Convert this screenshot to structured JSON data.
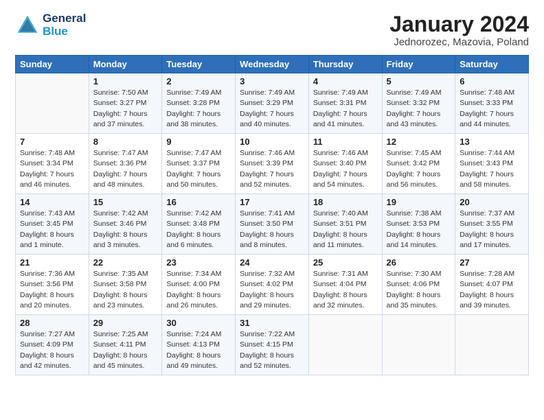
{
  "header": {
    "logo_line1": "General",
    "logo_line2": "Blue",
    "title": "January 2024",
    "subtitle": "Jednorozec, Mazovia, Poland"
  },
  "weekdays": [
    "Sunday",
    "Monday",
    "Tuesday",
    "Wednesday",
    "Thursday",
    "Friday",
    "Saturday"
  ],
  "weeks": [
    [
      {
        "day": "",
        "info": ""
      },
      {
        "day": "1",
        "info": "Sunrise: 7:50 AM\nSunset: 3:27 PM\nDaylight: 7 hours\nand 37 minutes."
      },
      {
        "day": "2",
        "info": "Sunrise: 7:49 AM\nSunset: 3:28 PM\nDaylight: 7 hours\nand 38 minutes."
      },
      {
        "day": "3",
        "info": "Sunrise: 7:49 AM\nSunset: 3:29 PM\nDaylight: 7 hours\nand 40 minutes."
      },
      {
        "day": "4",
        "info": "Sunrise: 7:49 AM\nSunset: 3:31 PM\nDaylight: 7 hours\nand 41 minutes."
      },
      {
        "day": "5",
        "info": "Sunrise: 7:49 AM\nSunset: 3:32 PM\nDaylight: 7 hours\nand 43 minutes."
      },
      {
        "day": "6",
        "info": "Sunrise: 7:48 AM\nSunset: 3:33 PM\nDaylight: 7 hours\nand 44 minutes."
      }
    ],
    [
      {
        "day": "7",
        "info": "Sunrise: 7:48 AM\nSunset: 3:34 PM\nDaylight: 7 hours\nand 46 minutes."
      },
      {
        "day": "8",
        "info": "Sunrise: 7:47 AM\nSunset: 3:36 PM\nDaylight: 7 hours\nand 48 minutes."
      },
      {
        "day": "9",
        "info": "Sunrise: 7:47 AM\nSunset: 3:37 PM\nDaylight: 7 hours\nand 50 minutes."
      },
      {
        "day": "10",
        "info": "Sunrise: 7:46 AM\nSunset: 3:39 PM\nDaylight: 7 hours\nand 52 minutes."
      },
      {
        "day": "11",
        "info": "Sunrise: 7:46 AM\nSunset: 3:40 PM\nDaylight: 7 hours\nand 54 minutes."
      },
      {
        "day": "12",
        "info": "Sunrise: 7:45 AM\nSunset: 3:42 PM\nDaylight: 7 hours\nand 56 minutes."
      },
      {
        "day": "13",
        "info": "Sunrise: 7:44 AM\nSunset: 3:43 PM\nDaylight: 7 hours\nand 58 minutes."
      }
    ],
    [
      {
        "day": "14",
        "info": "Sunrise: 7:43 AM\nSunset: 3:45 PM\nDaylight: 8 hours\nand 1 minute."
      },
      {
        "day": "15",
        "info": "Sunrise: 7:42 AM\nSunset: 3:46 PM\nDaylight: 8 hours\nand 3 minutes."
      },
      {
        "day": "16",
        "info": "Sunrise: 7:42 AM\nSunset: 3:48 PM\nDaylight: 8 hours\nand 6 minutes."
      },
      {
        "day": "17",
        "info": "Sunrise: 7:41 AM\nSunset: 3:50 PM\nDaylight: 8 hours\nand 8 minutes."
      },
      {
        "day": "18",
        "info": "Sunrise: 7:40 AM\nSunset: 3:51 PM\nDaylight: 8 hours\nand 11 minutes."
      },
      {
        "day": "19",
        "info": "Sunrise: 7:38 AM\nSunset: 3:53 PM\nDaylight: 8 hours\nand 14 minutes."
      },
      {
        "day": "20",
        "info": "Sunrise: 7:37 AM\nSunset: 3:55 PM\nDaylight: 8 hours\nand 17 minutes."
      }
    ],
    [
      {
        "day": "21",
        "info": "Sunrise: 7:36 AM\nSunset: 3:56 PM\nDaylight: 8 hours\nand 20 minutes."
      },
      {
        "day": "22",
        "info": "Sunrise: 7:35 AM\nSunset: 3:58 PM\nDaylight: 8 hours\nand 23 minutes."
      },
      {
        "day": "23",
        "info": "Sunrise: 7:34 AM\nSunset: 4:00 PM\nDaylight: 8 hours\nand 26 minutes."
      },
      {
        "day": "24",
        "info": "Sunrise: 7:32 AM\nSunset: 4:02 PM\nDaylight: 8 hours\nand 29 minutes."
      },
      {
        "day": "25",
        "info": "Sunrise: 7:31 AM\nSunset: 4:04 PM\nDaylight: 8 hours\nand 32 minutes."
      },
      {
        "day": "26",
        "info": "Sunrise: 7:30 AM\nSunset: 4:06 PM\nDaylight: 8 hours\nand 35 minutes."
      },
      {
        "day": "27",
        "info": "Sunrise: 7:28 AM\nSunset: 4:07 PM\nDaylight: 8 hours\nand 39 minutes."
      }
    ],
    [
      {
        "day": "28",
        "info": "Sunrise: 7:27 AM\nSunset: 4:09 PM\nDaylight: 8 hours\nand 42 minutes."
      },
      {
        "day": "29",
        "info": "Sunrise: 7:25 AM\nSunset: 4:11 PM\nDaylight: 8 hours\nand 45 minutes."
      },
      {
        "day": "30",
        "info": "Sunrise: 7:24 AM\nSunset: 4:13 PM\nDaylight: 8 hours\nand 49 minutes."
      },
      {
        "day": "31",
        "info": "Sunrise: 7:22 AM\nSunset: 4:15 PM\nDaylight: 8 hours\nand 52 minutes."
      },
      {
        "day": "",
        "info": ""
      },
      {
        "day": "",
        "info": ""
      },
      {
        "day": "",
        "info": ""
      }
    ]
  ]
}
